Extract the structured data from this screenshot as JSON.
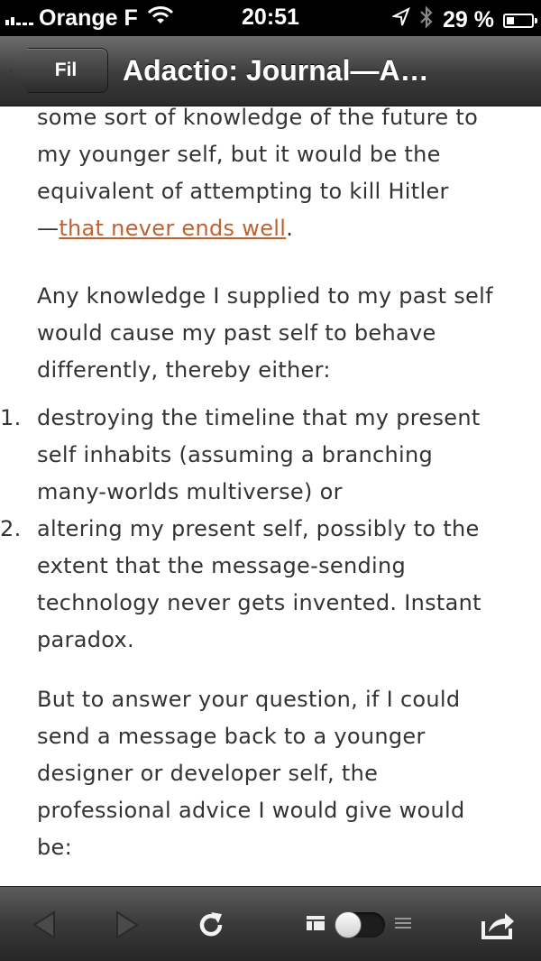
{
  "status_bar": {
    "carrier": "Orange F",
    "time": "20:51",
    "battery": "29 %",
    "battery_level": 0.29
  },
  "nav": {
    "back_label": "Fil",
    "title": "Adactio: Journal—A…"
  },
  "article": {
    "para1_lines": [
      "some sort of knowledge of the future to",
      "my younger self, but it would be the",
      "equivalent of attempting to kill Hitler"
    ],
    "para1_dash": "—",
    "para1_link": "that never ends well",
    "para1_end": ".",
    "para2": "Any knowledge I supplied to my past self would cause my past self to behave differently, thereby either:",
    "list": [
      {
        "num": "1.",
        "text": "destroying the timeline that my present self inhabits (assuming a branching many-worlds multiverse) or"
      },
      {
        "num": "2.",
        "text": "altering my present self, possibly to the extent that the message-sending technology never gets invented. Instant paradox."
      }
    ],
    "para3": "But to answer your question, if I could send a message back to a younger designer or developer self, the professional advice I would give would be:"
  },
  "toolbar": {
    "icons": [
      "back-arrow-icon",
      "forward-arrow-icon",
      "reload-icon",
      "reader-toggle",
      "share-icon"
    ]
  },
  "colors": {
    "link": "#c0622f",
    "text": "#333333",
    "nav_bg": "#3b3b3b"
  }
}
